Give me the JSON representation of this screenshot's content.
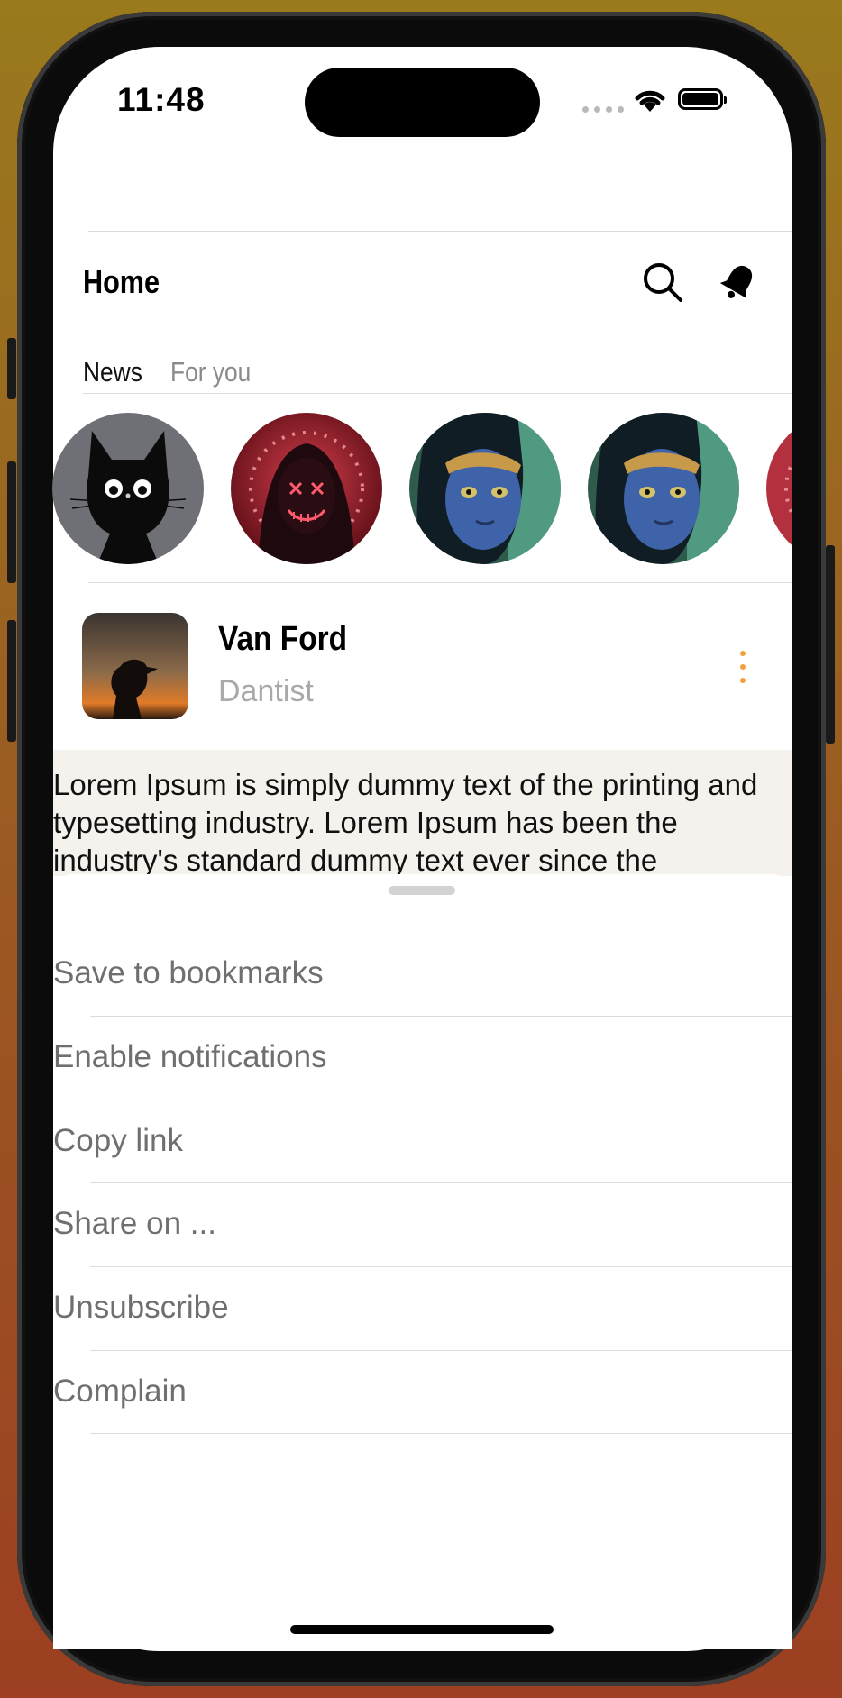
{
  "status_bar": {
    "time": "11:48"
  },
  "header": {
    "title": "Home"
  },
  "tabs": [
    {
      "label": "News",
      "active": true
    },
    {
      "label": "For you",
      "active": false
    }
  ],
  "stories": [
    {
      "subject": "black-cat-avatar"
    },
    {
      "subject": "neon-mask-hooded-figure"
    },
    {
      "subject": "blue-alien-face"
    },
    {
      "subject": "blue-alien-face"
    },
    {
      "subject": "neon-mask-hooded-figure"
    }
  ],
  "post": {
    "author": "Van Ford",
    "role": "Dantist",
    "text": "Lorem Ipsum is simply dummy text of the printing and typesetting industry. Lorem Ipsum has been the industry's standard dummy text ever since the"
  },
  "action_sheet": {
    "items": [
      {
        "label": "Save to bookmarks"
      },
      {
        "label": "Enable notifications"
      },
      {
        "label": "Copy link"
      },
      {
        "label": "Share on ..."
      },
      {
        "label": "Unsubscribe"
      },
      {
        "label": "Complain"
      }
    ]
  },
  "colors": {
    "accent": "#f0a040",
    "post_background": "#f5f1ec",
    "menu_text": "#6f6f6f",
    "secondary_text": "#a9a9a9"
  },
  "icons": [
    "search-icon",
    "notification-bell-icon",
    "more-vertical-icon",
    "wifi-icon",
    "battery-icon",
    "cellular-signal-icon"
  ]
}
